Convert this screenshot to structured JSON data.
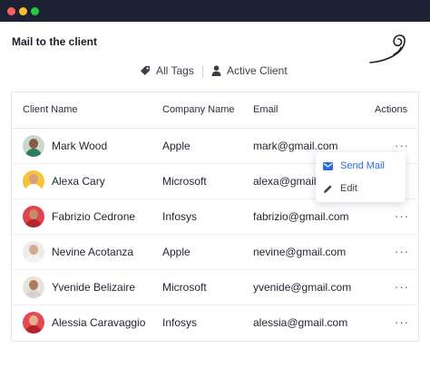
{
  "window": {
    "colors": {
      "close": "#ff5f57",
      "minimize": "#febc2e",
      "maximize": "#28c840",
      "titlebar": "#1c2133"
    }
  },
  "page": {
    "title": "Mail to the client",
    "logo_icon": "swirl-logo-icon"
  },
  "filters": {
    "all_tags": {
      "label": "All Tags",
      "icon": "tag-icon"
    },
    "active_client": {
      "label": "Active Client",
      "icon": "user-icon"
    }
  },
  "table": {
    "headers": {
      "client": "Client Name",
      "company": "Company Name",
      "email": "Email",
      "actions": "Actions"
    },
    "rows": [
      {
        "name": "Mark Wood",
        "company": "Apple",
        "email": "mark@gmail.com"
      },
      {
        "name": "Alexa Cary",
        "company": "Microsoft",
        "email": "alexa@gmail.com"
      },
      {
        "name": "Fabrizio Cedrone",
        "company": "Infosys",
        "email": "fabrizio@gmail.com"
      },
      {
        "name": "Nevine Acotanza",
        "company": "Apple",
        "email": "nevine@gmail.com"
      },
      {
        "name": "Yvenide Belizaire",
        "company": "Microsoft",
        "email": "yvenide@gmail.com"
      },
      {
        "name": "Alessia Caravaggio",
        "company": "Infosys",
        "email": "alessia@gmail.com"
      }
    ],
    "actions_glyph": "···"
  },
  "action_menu": {
    "send_mail": {
      "label": "Send Mail",
      "icon": "mail-icon",
      "color": "#2d6cdf"
    },
    "edit": {
      "label": "Edit",
      "icon": "pencil-icon"
    }
  }
}
